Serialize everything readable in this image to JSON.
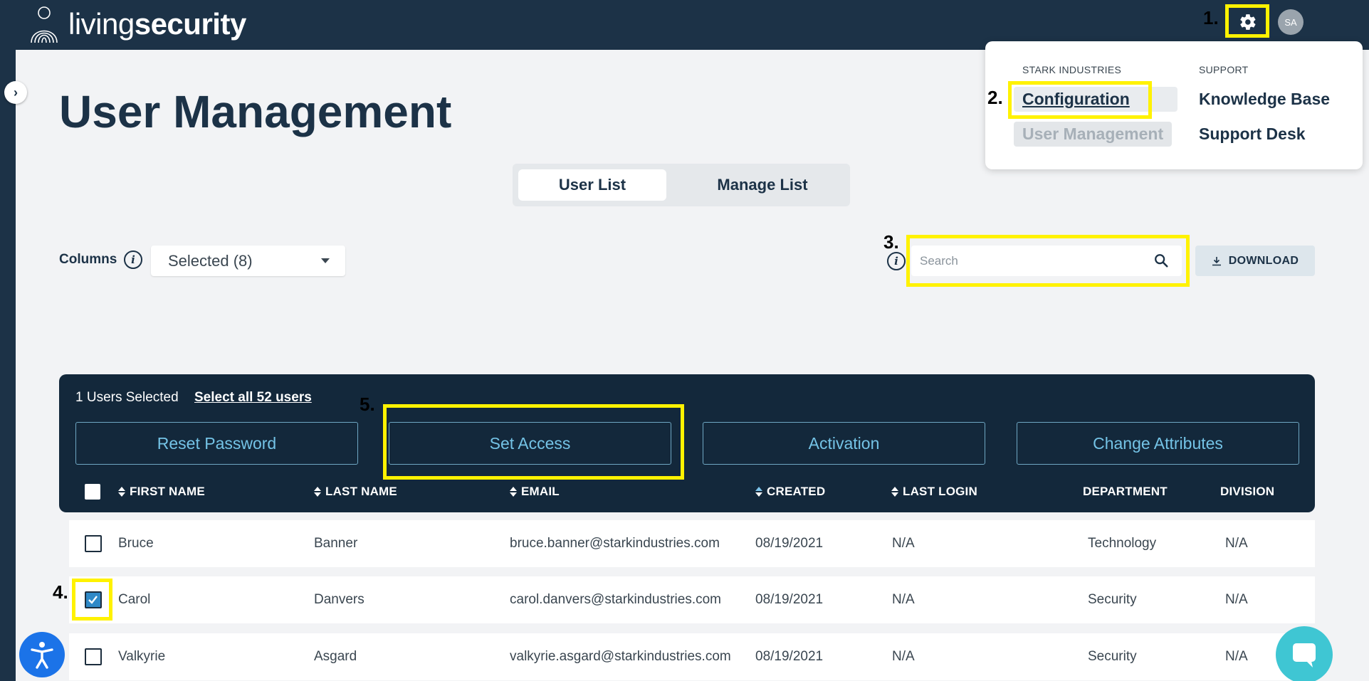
{
  "brand": {
    "name_light": "living",
    "name_bold": "security"
  },
  "header": {
    "avatar_initials": "SA"
  },
  "annotations": [
    "1.",
    "2.",
    "3.",
    "4.",
    "5."
  ],
  "menu": {
    "org_heading": "STARK INDUSTRIES",
    "support_heading": "SUPPORT",
    "org_items": [
      "Configuration",
      "User Management"
    ],
    "support_items": [
      "Knowledge Base",
      "Support Desk"
    ]
  },
  "page": {
    "title": "User Management"
  },
  "tabs": [
    "User List",
    "Manage List"
  ],
  "toolbar": {
    "columns_label": "Columns",
    "columns_value": "Selected (8)",
    "search_placeholder": "Search",
    "download_label": "DOWNLOAD"
  },
  "bulk": {
    "selected_text": "1 Users Selected",
    "select_all_text": "Select all 52 users",
    "actions": [
      "Reset Password",
      "Set Access",
      "Activation",
      "Change Attributes"
    ]
  },
  "table": {
    "columns": [
      "FIRST NAME",
      "LAST NAME",
      "EMAIL",
      "CREATED",
      "LAST LOGIN",
      "DEPARTMENT",
      "DIVISION"
    ],
    "rows": [
      {
        "checked": false,
        "first": "Bruce",
        "last": "Banner",
        "email": "bruce.banner@starkindustries.com",
        "created": "08/19/2021",
        "last_login": "N/A",
        "department": "Technology",
        "division": "N/A"
      },
      {
        "checked": true,
        "first": "Carol",
        "last": "Danvers",
        "email": "carol.danvers@starkindustries.com",
        "created": "08/19/2021",
        "last_login": "N/A",
        "department": "Security",
        "division": "N/A"
      },
      {
        "checked": false,
        "first": "Valkyrie",
        "last": "Asgard",
        "email": "valkyrie.asgard@starkindustries.com",
        "created": "08/19/2021",
        "last_login": "N/A",
        "department": "Security",
        "division": "N/A"
      }
    ]
  },
  "colors": {
    "navy": "#1c3247",
    "panel": "#13283b",
    "highlight": "#fff200",
    "accent": "#74c3e6"
  },
  "icons": [
    "gear-icon",
    "search-icon",
    "download-icon",
    "info-icon",
    "chevron-right-icon",
    "sort-icon",
    "accessibility-icon",
    "chat-icon",
    "fingerprint-logo-icon"
  ]
}
